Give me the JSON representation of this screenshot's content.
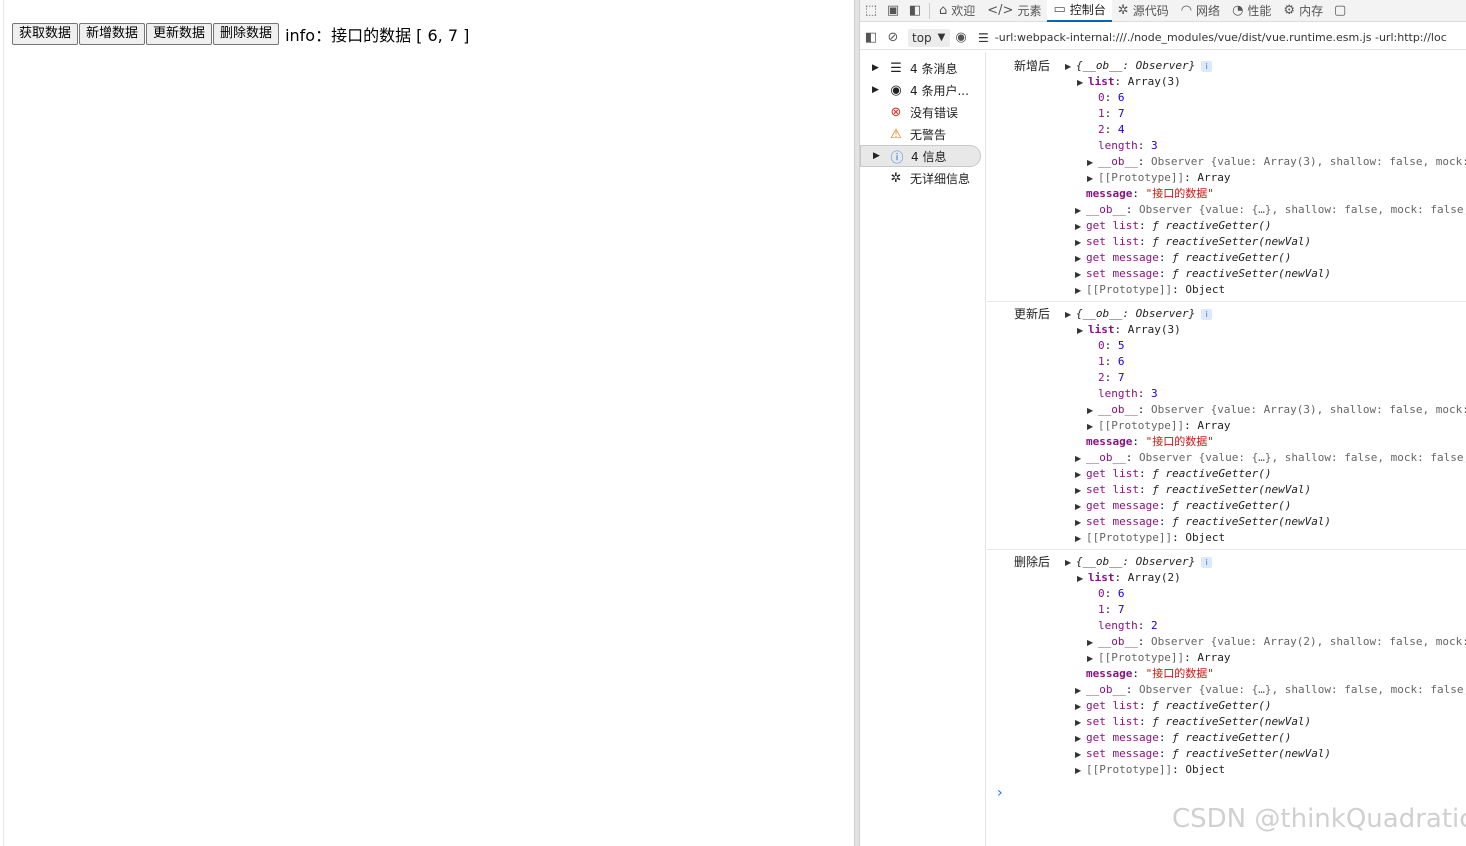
{
  "page": {
    "buttons": [
      "获取数据",
      "新增数据",
      "更新数据",
      "删除数据"
    ],
    "info": "info：接口的数据 [ 6, 7 ]"
  },
  "devtools": {
    "tabs": [
      {
        "icon": "home-icon",
        "label": "欢迎"
      },
      {
        "icon": "code-icon",
        "label": "元素"
      },
      {
        "icon": "console-icon",
        "label": "控制台",
        "active": true
      },
      {
        "icon": "bug-icon",
        "label": "源代码"
      },
      {
        "icon": "wifi-icon",
        "label": "网络"
      },
      {
        "icon": "performance-icon",
        "label": "性能"
      },
      {
        "icon": "gear-icon",
        "label": "内存"
      }
    ],
    "context": "top",
    "filter": "-url:webpack-internal:///./node_modules/vue/dist/vue.runtime.esm.js -url:http://loc",
    "sidebar": [
      {
        "icon": "list-icon",
        "label": "4 条消息"
      },
      {
        "icon": "user-icon",
        "label": "4 条用户..."
      },
      {
        "icon": "error-icon",
        "label": "没有错误"
      },
      {
        "icon": "warning-icon",
        "label": "无警告"
      },
      {
        "icon": "info-icon",
        "label": "4 信息"
      },
      {
        "icon": "bug-icon",
        "label": "无详细信息"
      }
    ]
  },
  "console_entries": [
    {
      "label": "新增后",
      "header": "{__ob__: Observer}",
      "list_header": "Array(3)",
      "items": [
        [
          "0",
          "6"
        ],
        [
          "1",
          "7"
        ],
        [
          "2",
          "4"
        ]
      ],
      "length": "3",
      "list_ob": "Observer {value: Array(3), shallow: false, mock:",
      "list_proto": "Array",
      "message": "\"接口的数据\"",
      "ob": "Observer {value: {…}, shallow: false, mock: false,",
      "get_list": "reactiveGetter()",
      "set_list": "reactiveSetter(newVal)",
      "get_message": "reactiveGetter()",
      "set_message": "reactiveSetter(newVal)",
      "proto": "Object"
    },
    {
      "label": "更新后",
      "header": "{__ob__: Observer}",
      "list_header": "Array(3)",
      "items": [
        [
          "0",
          "5"
        ],
        [
          "1",
          "6"
        ],
        [
          "2",
          "7"
        ]
      ],
      "length": "3",
      "list_ob": "Observer {value: Array(3), shallow: false, mock:",
      "list_proto": "Array",
      "message": "\"接口的数据\"",
      "ob": "Observer {value: {…}, shallow: false, mock: false,",
      "get_list": "reactiveGetter()",
      "set_list": "reactiveSetter(newVal)",
      "get_message": "reactiveGetter()",
      "set_message": "reactiveSetter(newVal)",
      "proto": "Object"
    },
    {
      "label": "删除后",
      "header": "{__ob__: Observer}",
      "list_header": "Array(2)",
      "items": [
        [
          "0",
          "6"
        ],
        [
          "1",
          "7"
        ]
      ],
      "length": "2",
      "list_ob": "Observer {value: Array(2), shallow: false, mock:",
      "list_proto": "Array",
      "message": "\"接口的数据\"",
      "ob": "Observer {value: {…}, shallow: false, mock: false,",
      "get_list": "reactiveGetter()",
      "set_list": "reactiveSetter(newVal)",
      "get_message": "reactiveGetter()",
      "set_message": "reactiveSetter(newVal)",
      "proto": "Object"
    }
  ],
  "prompt": "›",
  "watermark": "CSDN @thinkQuadratic"
}
